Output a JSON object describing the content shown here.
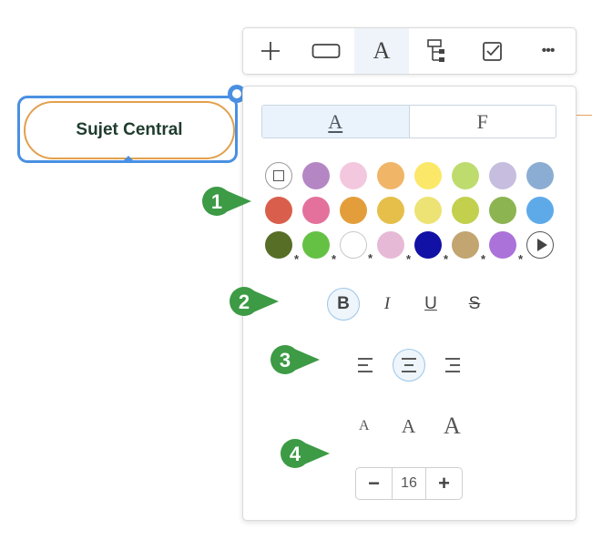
{
  "toolbar": {
    "buttons": [
      {
        "name": "add-icon"
      },
      {
        "name": "shape-icon"
      },
      {
        "name": "text-format-icon",
        "label": "A",
        "active": true
      },
      {
        "name": "structure-icon"
      },
      {
        "name": "task-icon"
      },
      {
        "name": "more-icon",
        "label": "•••"
      }
    ]
  },
  "node": {
    "label": "Sujet Central",
    "border_color": "#e2a04e",
    "selection_color": "#4a90e2"
  },
  "panel": {
    "tabs": [
      {
        "label": "A",
        "active": true
      },
      {
        "label": "F",
        "active": false
      }
    ],
    "palette": [
      [
        "none",
        "#b586c4",
        "#f3c8de",
        "#f0b567",
        "#fbe869",
        "#bedc6e",
        "#c6bddf",
        "#8cadd3"
      ],
      [
        "#d95f4c",
        "#e3719b",
        "#e39e3b",
        "#e5bf49",
        "#ede374",
        "#c2d04d",
        "#8cb451",
        "#5eaae9"
      ],
      [
        "#566e26",
        "#65c144",
        "#ffffff",
        "#e6bad6",
        "#1111a6",
        "#c2a571",
        "#ab72da",
        "more"
      ]
    ],
    "style_buttons": [
      {
        "label": "B",
        "name": "bold-button",
        "active": true
      },
      {
        "label": "I",
        "name": "italic-button",
        "active": false
      },
      {
        "label": "U",
        "name": "underline-button",
        "active": false
      },
      {
        "label": "S",
        "name": "strikethrough-button",
        "active": false
      }
    ],
    "align_buttons": [
      {
        "name": "align-left-button",
        "active": false
      },
      {
        "name": "align-center-button",
        "active": true
      },
      {
        "name": "align-right-button",
        "active": false
      }
    ],
    "size_presets": [
      "A",
      "A",
      "A"
    ],
    "font_size": {
      "minus": "−",
      "value": "16",
      "plus": "+"
    }
  },
  "callouts": [
    "1",
    "2",
    "3",
    "4"
  ],
  "colors": {
    "accent": "#4a90e2",
    "callout_green": "#3d9a45"
  }
}
